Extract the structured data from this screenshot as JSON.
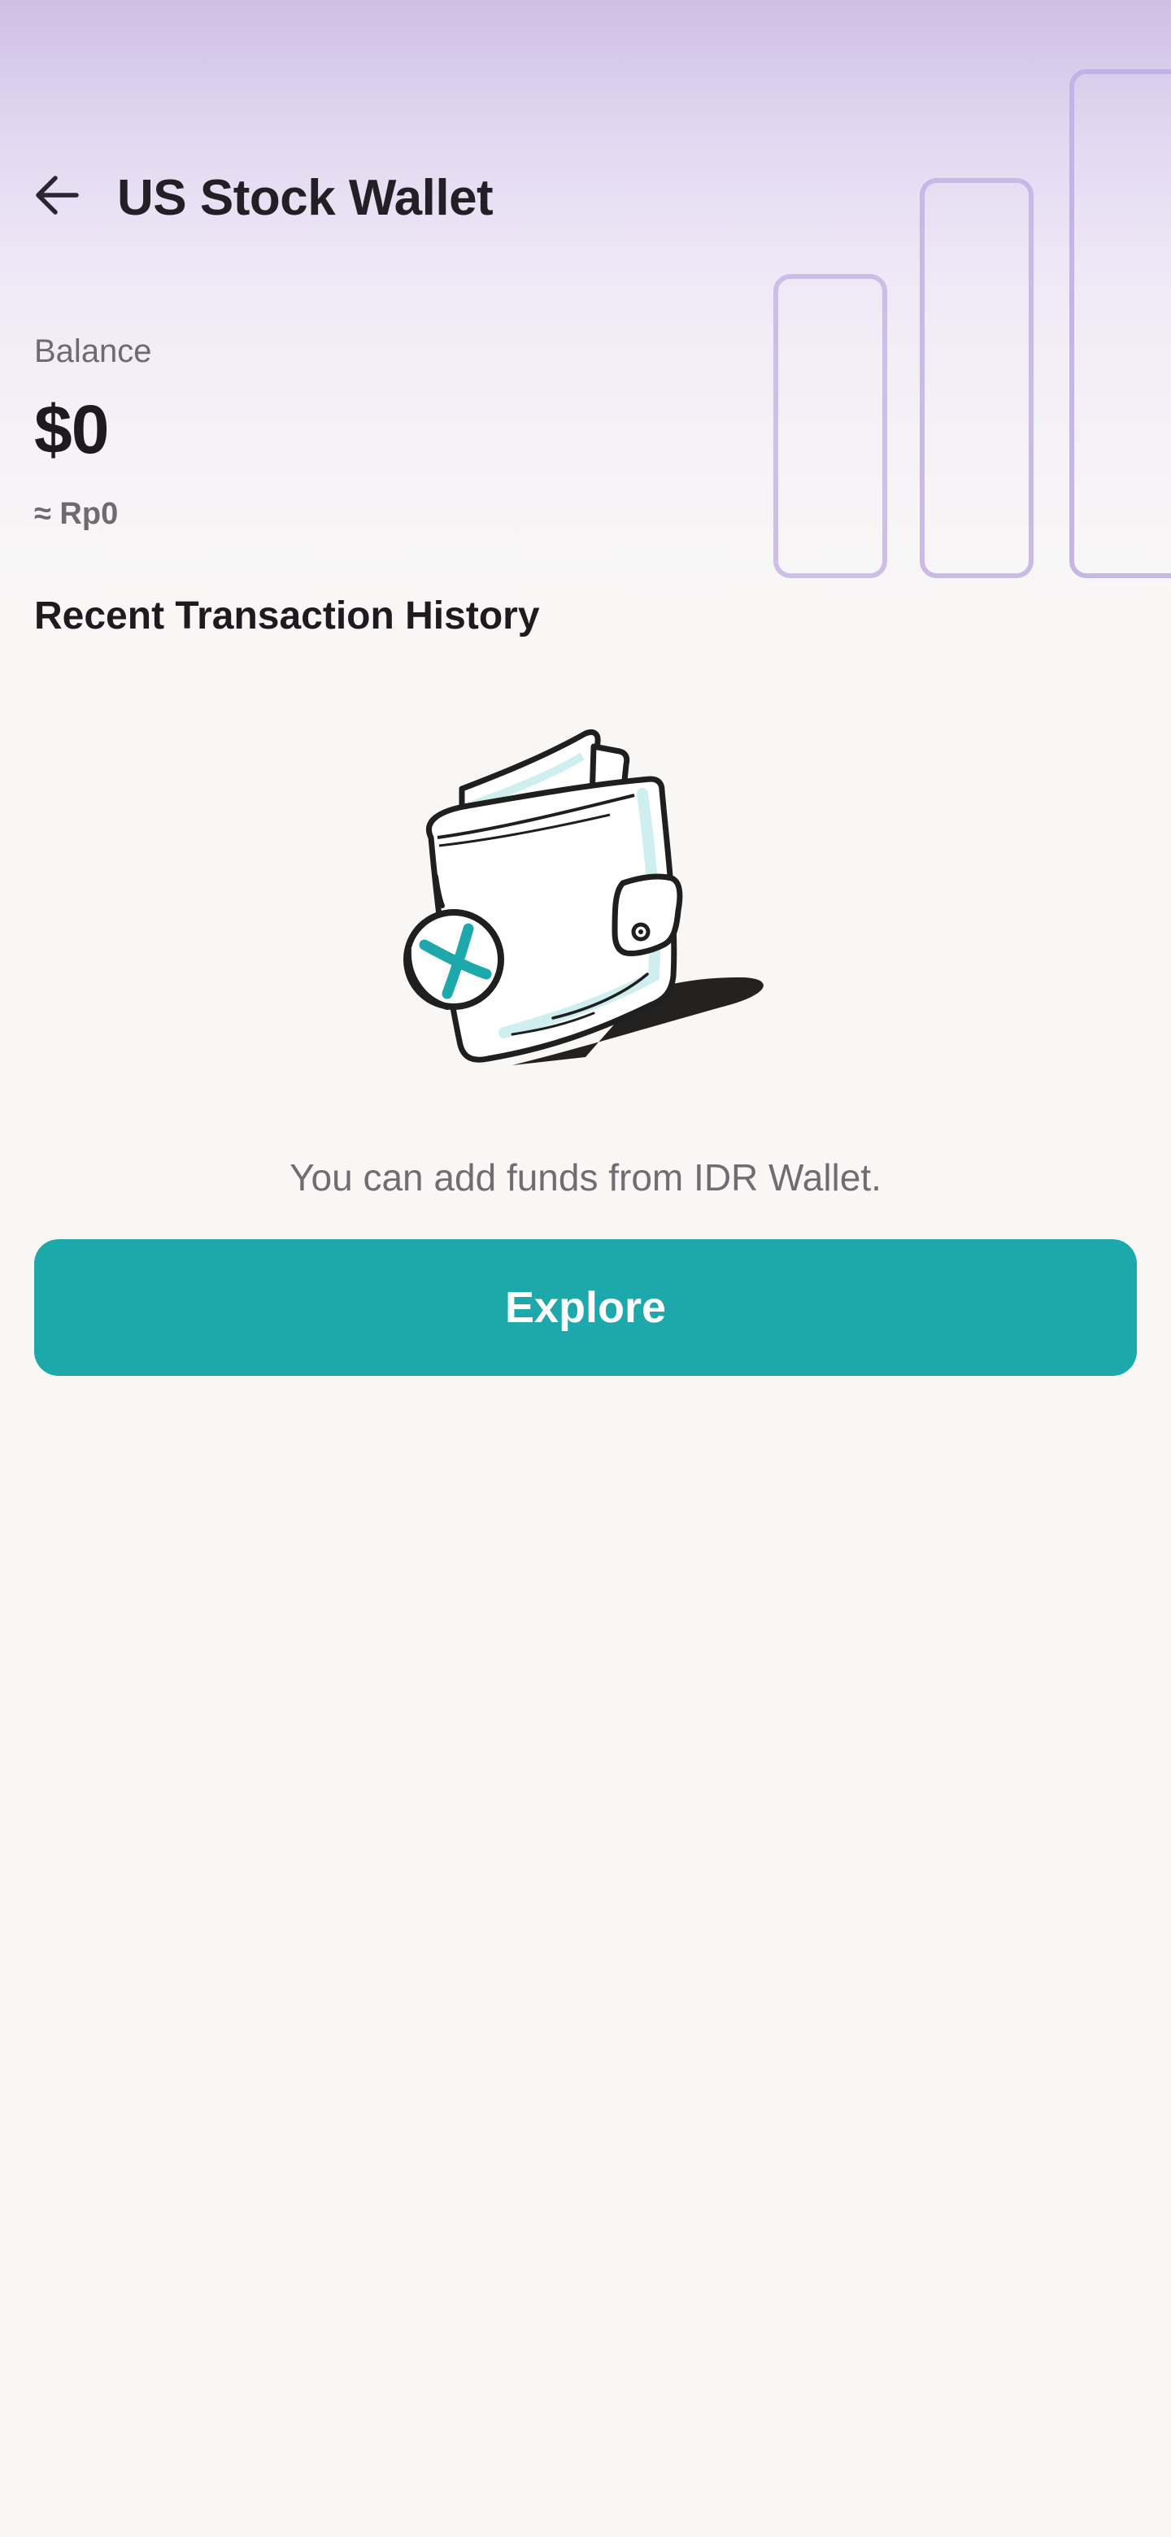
{
  "header": {
    "title": "US Stock Wallet",
    "back_icon": "arrow-left-icon"
  },
  "balance": {
    "label": "Balance",
    "usd_value": "$0",
    "idr_value": "≈ Rp0"
  },
  "transactions": {
    "section_title": "Recent Transaction History",
    "illustration_icon": "empty-wallet-illustration",
    "empty_message": "You can add funds from IDR Wallet.",
    "explore_label": "Explore"
  },
  "colors": {
    "accent": "#1da8ab",
    "header_gradient_top": "#cfbfe3",
    "background": "#f8f7f5",
    "bar_outline": "#c8b9e8"
  }
}
